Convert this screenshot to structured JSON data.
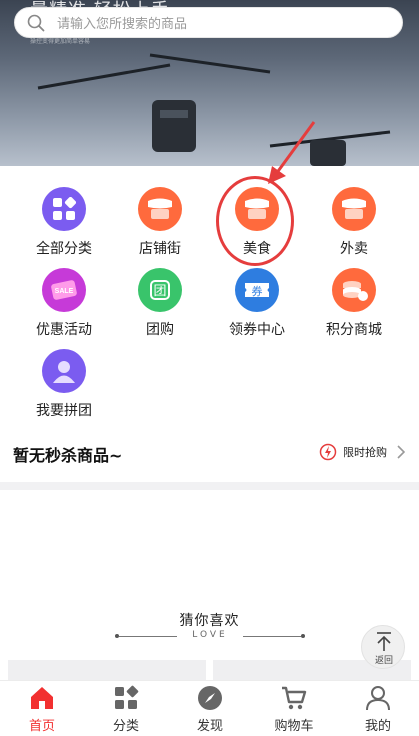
{
  "banner": {
    "title_partial": "量精准 轻松上手",
    "subtitle_partial": "操控变得更加简单容易"
  },
  "search": {
    "placeholder": "请输入您所搜索的商品"
  },
  "categories": [
    {
      "label": "全部分类",
      "icon": "all-categories-icon",
      "color": "#7b5cf0"
    },
    {
      "label": "店铺街",
      "icon": "shop-street-icon",
      "color": "#ff6a3d"
    },
    {
      "label": "美食",
      "icon": "food-icon",
      "color": "#ff6a3d"
    },
    {
      "label": "外卖",
      "icon": "takeout-icon",
      "color": "#ff6a3d"
    },
    {
      "label": "优惠活动",
      "icon": "sale-icon",
      "color": "#c63ad8",
      "badge": "SALE"
    },
    {
      "label": "团购",
      "icon": "group-buy-icon",
      "color": "#39c46b",
      "glyph": "团"
    },
    {
      "label": "领券中心",
      "icon": "coupon-icon",
      "color": "#2e7de0",
      "glyph": "券"
    },
    {
      "label": "积分商城",
      "icon": "points-mall-icon",
      "color": "#ff6a3d"
    },
    {
      "label": "我要拼团",
      "icon": "join-group-icon",
      "color": "#7b5cf0"
    }
  ],
  "flash_sale": {
    "title": "暂无秒杀商品~",
    "link_label": "限时抢购"
  },
  "guess": {
    "title": "猜你喜欢",
    "subtitle": "LOVE"
  },
  "back_top": {
    "label": "返回"
  },
  "tabbar": [
    {
      "label": "首页",
      "icon": "home-icon",
      "active": true
    },
    {
      "label": "分类",
      "icon": "category-icon",
      "active": false
    },
    {
      "label": "发现",
      "icon": "compass-icon",
      "active": false
    },
    {
      "label": "购物车",
      "icon": "cart-icon",
      "active": false
    },
    {
      "label": "我的",
      "icon": "user-icon",
      "active": false
    }
  ],
  "colors": {
    "accent": "#f23030",
    "annotation": "#e53d3d"
  }
}
